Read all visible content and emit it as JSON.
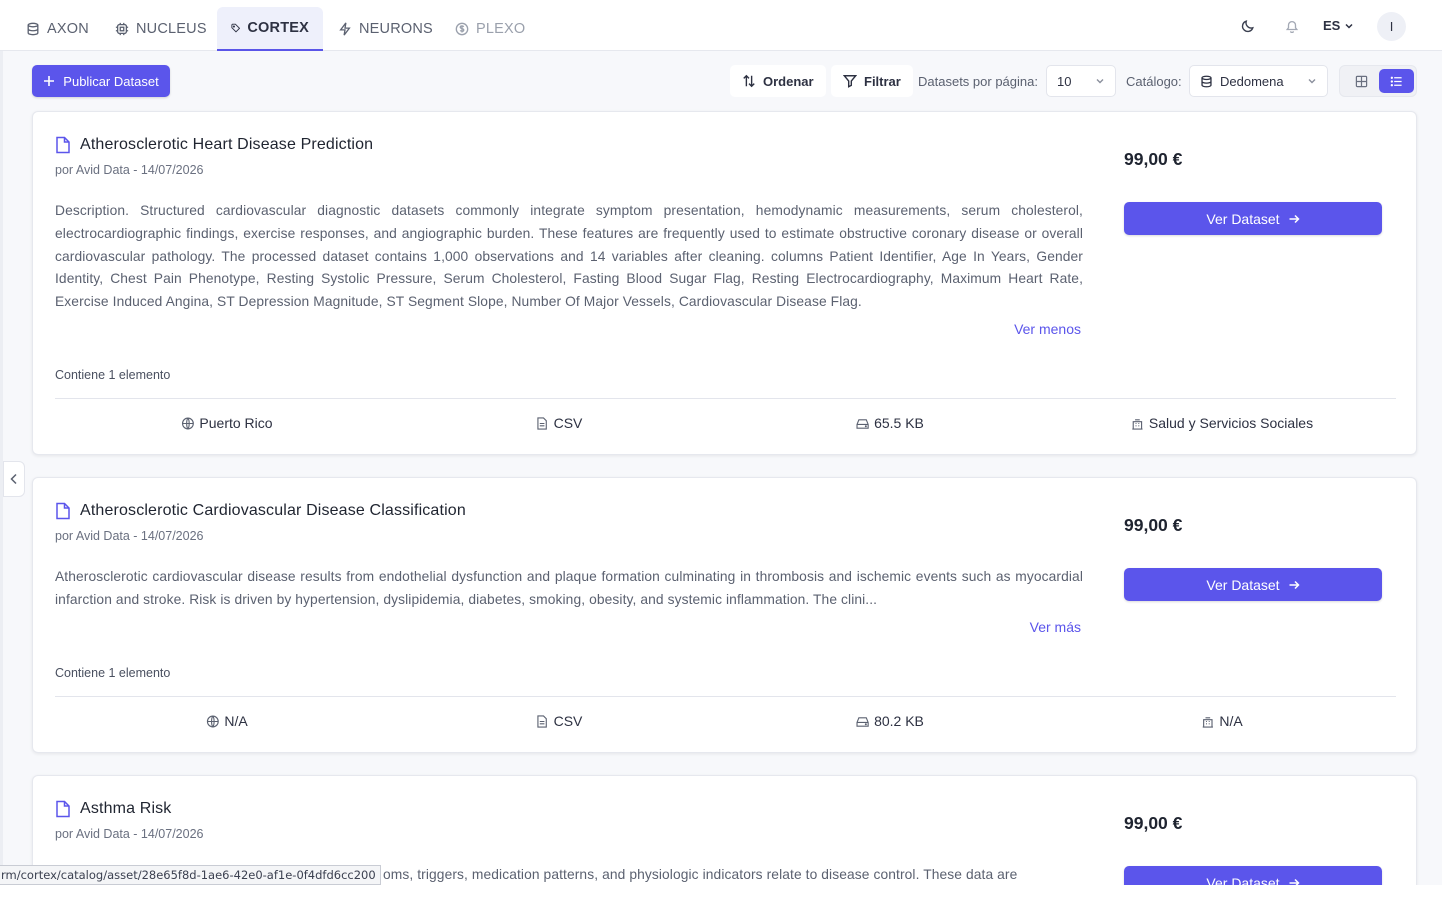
{
  "nav": {
    "tabs": [
      {
        "label": "AXON",
        "icon": "database-icon"
      },
      {
        "label": "NUCLEUS",
        "icon": "chip-icon"
      },
      {
        "label": "CORTEX",
        "icon": "tag-icon",
        "active": true
      },
      {
        "label": "NEURONS",
        "icon": "bolt-icon"
      },
      {
        "label": "PLEXO",
        "icon": "coin-icon",
        "muted": true
      }
    ],
    "lang": "ES",
    "avatar": "I"
  },
  "toolbar": {
    "publish_label": "Publicar Dataset",
    "sort_label": "Ordenar",
    "filter_label": "Filtrar",
    "per_page_label": "Datasets por página:",
    "per_page_value": "10",
    "catalog_label": "Catálogo:",
    "catalog_value": "Dedomena"
  },
  "cards": [
    {
      "title": "Atherosclerotic Heart Disease Prediction",
      "meta": "por Avid Data - 14/07/2026",
      "description": "Description. Structured cardiovascular diagnostic datasets commonly integrate symptom presentation, hemodynamic measurements, serum cholesterol, electrocardiographic findings, exercise responses, and angiographic burden. These features are frequently used to estimate obstructive coronary disease or overall cardiovascular pathology. The processed dataset contains 1,000 observations and 14 variables after cleaning. columns Patient Identifier, Age In Years, Gender Identity, Chest Pain Phenotype, Resting Systolic Pressure, Serum Cholesterol, Fasting Blood Sugar Flag, Resting Electrocardiography, Maximum Heart Rate, Exercise Induced Angina, ST Depression Magnitude, ST Segment Slope, Number Of Major Vessels, Cardiovascular Disease Flag.",
      "toggle": "Ver menos",
      "contains": "Contiene 1 elemento",
      "location": "Puerto Rico",
      "format": "CSV",
      "size": "65.5 KB",
      "category": "Salud y Servicios Sociales",
      "price": "99,00 €",
      "button": "Ver Dataset"
    },
    {
      "title": "Atherosclerotic Cardiovascular Disease Classification",
      "meta": "por Avid Data - 14/07/2026",
      "description": "Atherosclerotic cardiovascular disease results from endothelial dysfunction and plaque formation culminating in thrombosis and ischemic events such as myocardial infarction and stroke. Risk is driven by hypertension, dyslipidemia, diabetes, smoking, obesity, and systemic inflammation. The clini...",
      "toggle": "Ver más",
      "contains": "Contiene 1 elemento",
      "location": "N/A",
      "format": "CSV",
      "size": "80.2 KB",
      "category": "N/A",
      "price": "99,00 €",
      "button": "Ver Dataset"
    },
    {
      "title": "Asthma Risk",
      "meta": "por Avid Data - 14/07/2026",
      "description": "oms, triggers, medication patterns, and physiologic indicators relate to disease control. These data are",
      "price": "99,00 €",
      "button": "Ver Dataset"
    }
  ],
  "status_url": "rm/cortex/catalog/asset/28e65f8d-1ae6-42e0-af1e-0f4dfd6cc200",
  "colors": {
    "primary": "#5b55eb",
    "text": "#1f2430",
    "muted": "#5b6170"
  }
}
